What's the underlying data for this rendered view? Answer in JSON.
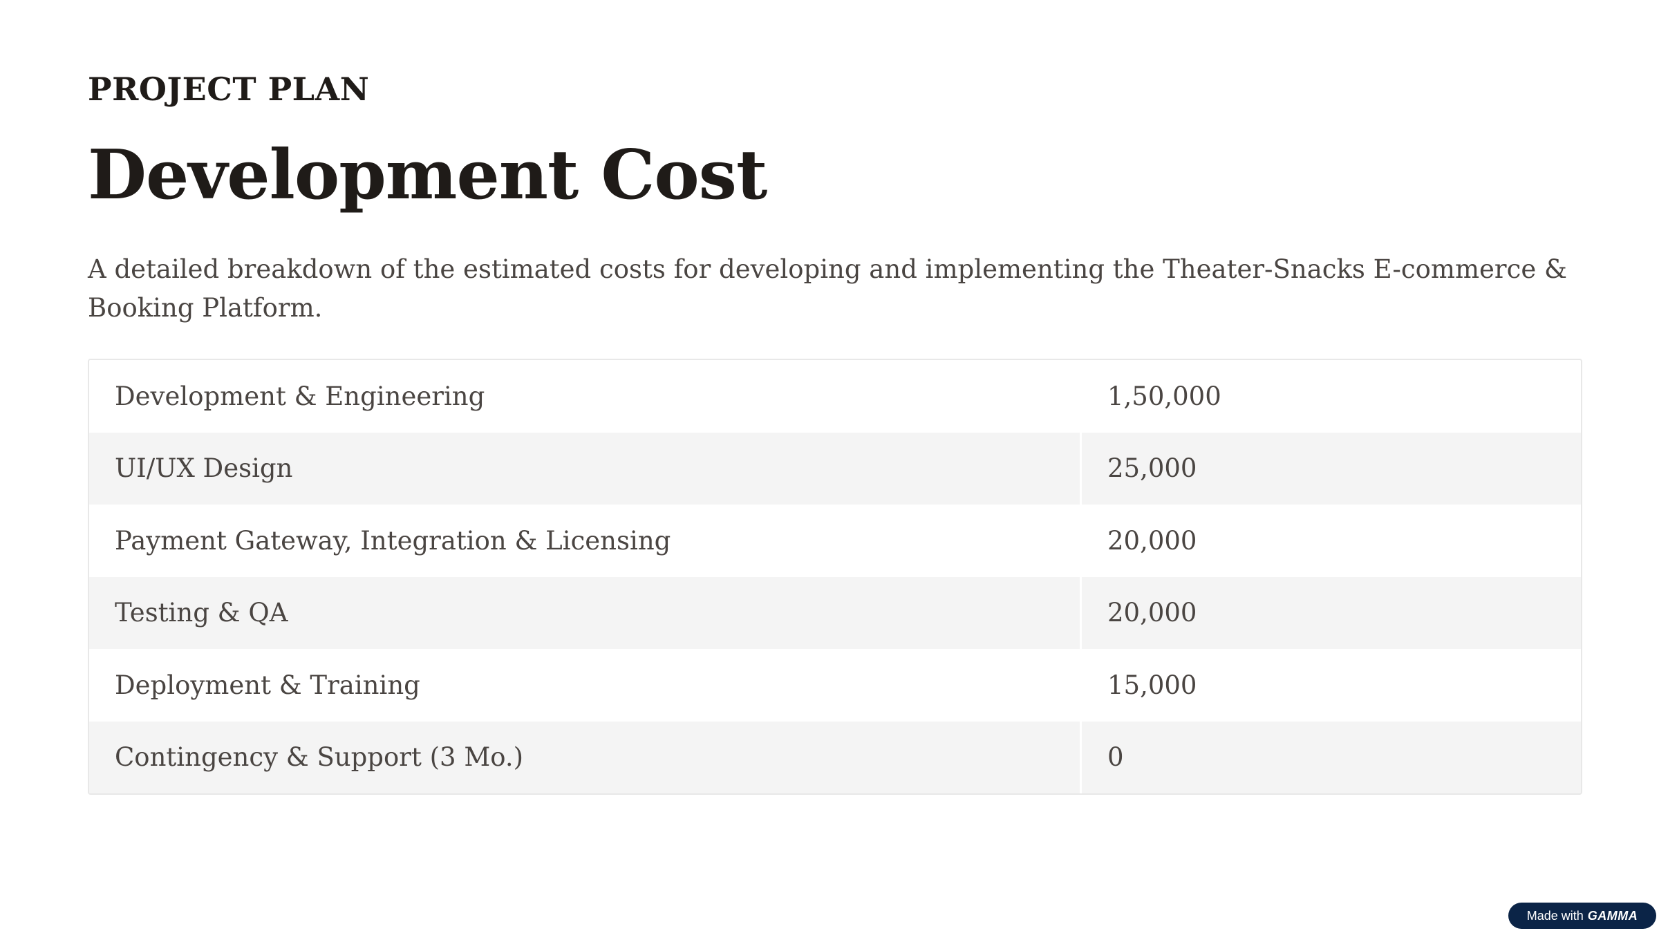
{
  "slide": {
    "eyebrow": "PROJECT PLAN",
    "title": "Development Cost",
    "subtitle": "A detailed breakdown of the estimated costs for developing and implementing the Theater-Snacks E-commerce & Booking Platform."
  },
  "cost_table": {
    "rows": [
      {
        "item": "Development & Engineering",
        "cost": "1,50,000"
      },
      {
        "item": "UI/UX Design",
        "cost": "25,000"
      },
      {
        "item": "Payment Gateway, Integration & Licensing",
        "cost": "20,000"
      },
      {
        "item": "Testing & QA",
        "cost": "20,000"
      },
      {
        "item": "Deployment & Training",
        "cost": "15,000"
      },
      {
        "item": "Contingency & Support (3 Mo.)",
        "cost": "0"
      }
    ]
  },
  "badge": {
    "prefix": "Made with",
    "brand": "GAMMA"
  }
}
